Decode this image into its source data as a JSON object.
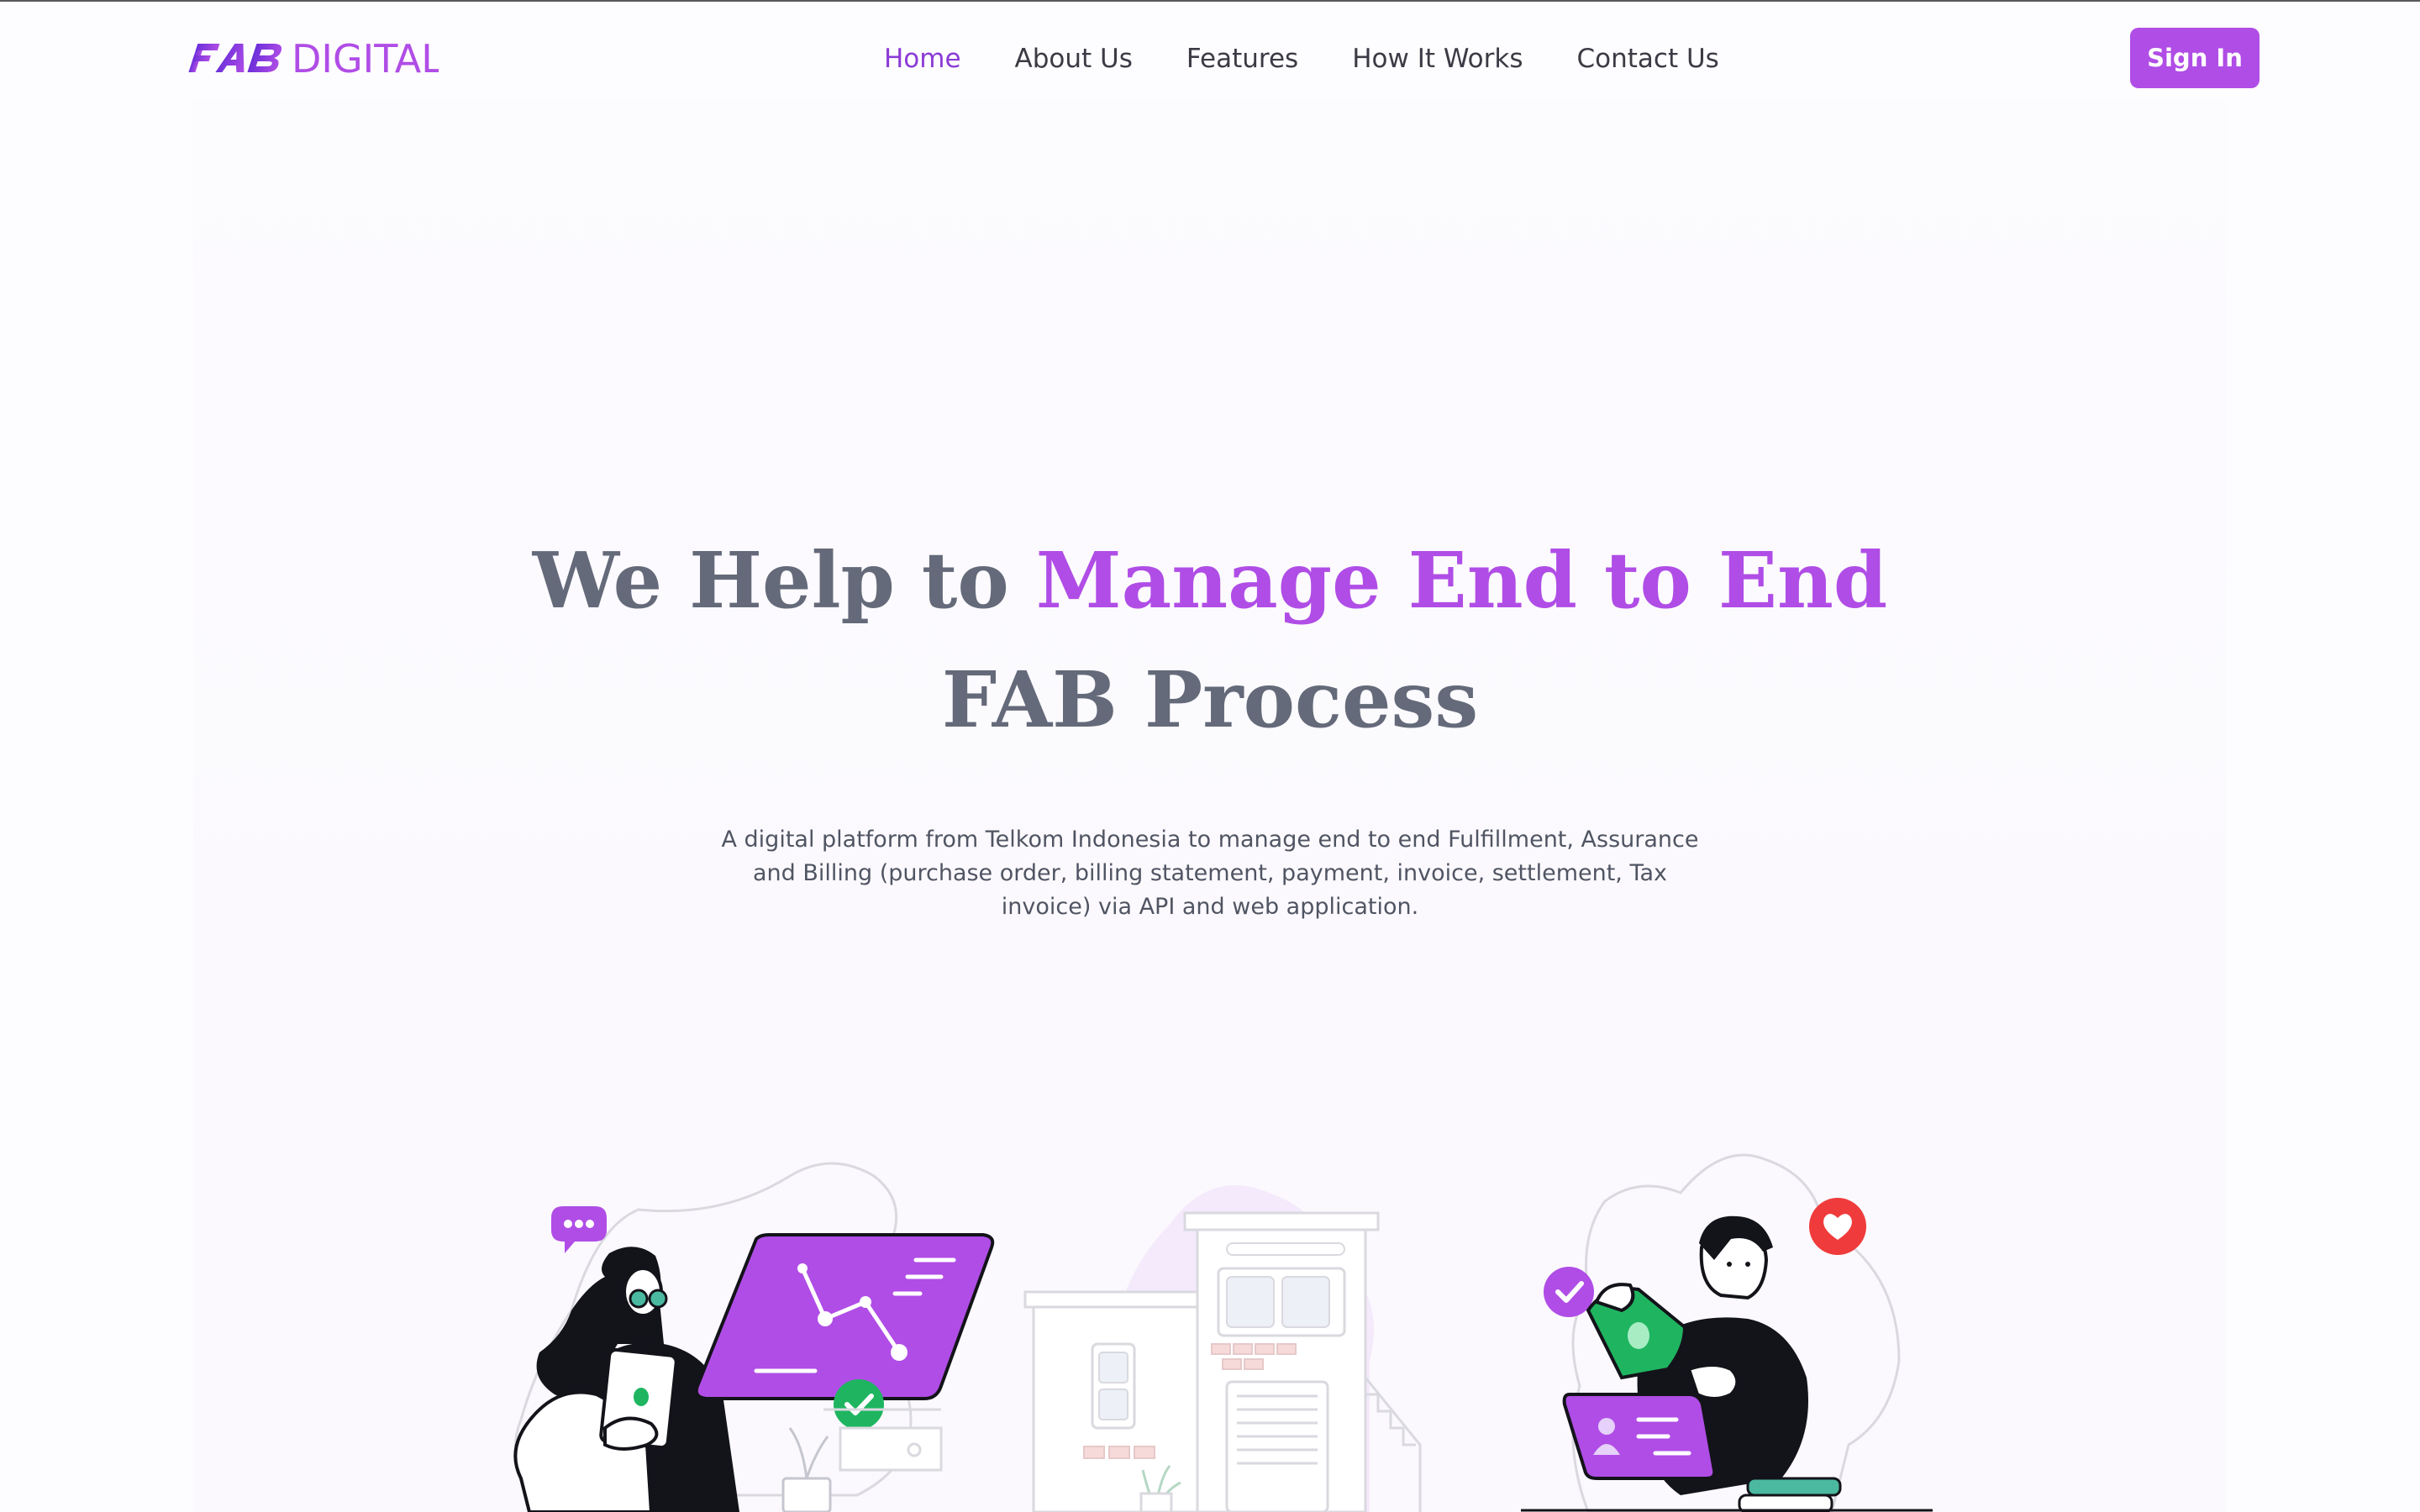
{
  "header": {
    "logo": {
      "text_fab": "FAB",
      "text_digital": "DIGITAL",
      "brand_color": "#b04de6"
    },
    "nav": [
      {
        "label": "Home",
        "active": true
      },
      {
        "label": "About Us",
        "active": false
      },
      {
        "label": "Features",
        "active": false
      },
      {
        "label": "How It Works",
        "active": false
      },
      {
        "label": "Contact Us",
        "active": false
      }
    ],
    "signin_label": "Sign In"
  },
  "hero": {
    "title_part1": "We Help to ",
    "title_accent": "Manage End to End",
    "title_part2": "FAB Process",
    "description": "A digital platform from Telkom Indonesia to manage end to end Fulfillment, Assurance and Billing (purchase order, billing statement, payment, invoice, settlement, Tax invoice) via API and web application."
  },
  "illustrations": [
    {
      "icon": "woman-with-chart-illustration"
    },
    {
      "icon": "building-illustration"
    },
    {
      "icon": "man-with-money-illustration"
    }
  ],
  "colors": {
    "accent": "#b04de6",
    "nav_active": "#8b3bd6",
    "title_gray": "#646a79",
    "success": "#1fb560",
    "heart": "#ef3b3b"
  }
}
